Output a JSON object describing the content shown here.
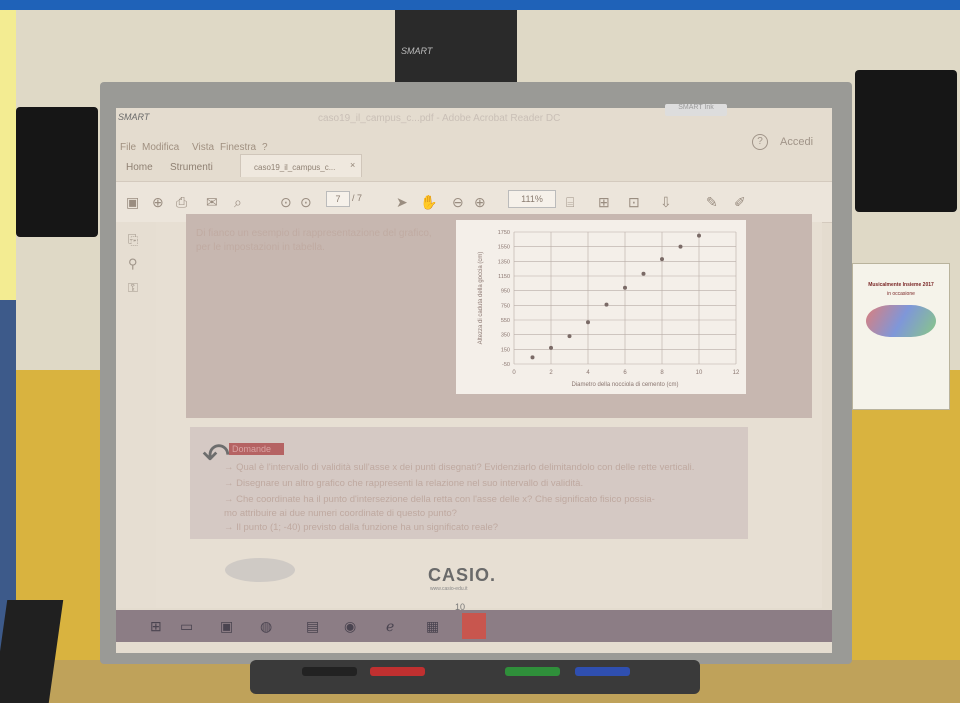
{
  "app": {
    "title": "caso19_il_campus_c...pdf - Adobe Acrobat Reader DC",
    "smart_logo": "SMART",
    "smart_ink": "SMART Ink",
    "help": "?",
    "login": "Accedi"
  },
  "menu": [
    "File",
    "Modifica",
    "Vista",
    "Finestra",
    "?"
  ],
  "tabs": {
    "home": "Home",
    "tools": "Strumenti",
    "doc": "caso19_il_campus_c..."
  },
  "toolbar": {
    "page_current": "7",
    "page_total": "/ 7",
    "zoom": "111%"
  },
  "panel1": {
    "text": "Di fianco un esempio di rappresentazione del grafico, per le impostazioni in tabella."
  },
  "chart_data": {
    "type": "scatter",
    "xlabel": "Diametro della nocciola di cemento (cm)",
    "ylabel": "Altezza di caduta della goccia (cm)",
    "xlim": [
      0,
      12
    ],
    "ylim": [
      -50,
      1750
    ],
    "xticks": [
      "0",
      "2",
      "4",
      "6",
      "8",
      "10",
      "12"
    ],
    "yticks": [
      "-50",
      "150",
      "350",
      "550",
      "750",
      "950",
      "1150",
      "1350",
      "1550",
      "1750"
    ],
    "series": [
      {
        "x": [
          1,
          2,
          3,
          4,
          5,
          6,
          7,
          8,
          9,
          10
        ],
        "y": [
          40,
          170,
          330,
          520,
          760,
          990,
          1180,
          1380,
          1550,
          1700
        ]
      }
    ]
  },
  "panel2": {
    "heading": "Domande",
    "lines": [
      "→ Qual è l'intervallo di validità sull'asse x dei punti disegnati? Evidenziarlo delimitandolo con delle rette verticali.",
      "→ Disegnare un altro grafico che rappresenti la relazione nel suo intervallo di validità.",
      "→ Che coordinate ha il punto d'intersezione della retta con l'asse delle x? Che significato fisico possia-",
      "mo attribuire ai due numeri coordinate di questo punto?",
      "→ Il punto (1; -40) previsto dalla funzione ha un significato reale?"
    ]
  },
  "footer": {
    "brand": "CASIO.",
    "url": "www.casio-edu.it",
    "page": "10"
  },
  "poster": {
    "title": "Musicalmente Insieme 2017",
    "subtitle": "in occasione"
  }
}
